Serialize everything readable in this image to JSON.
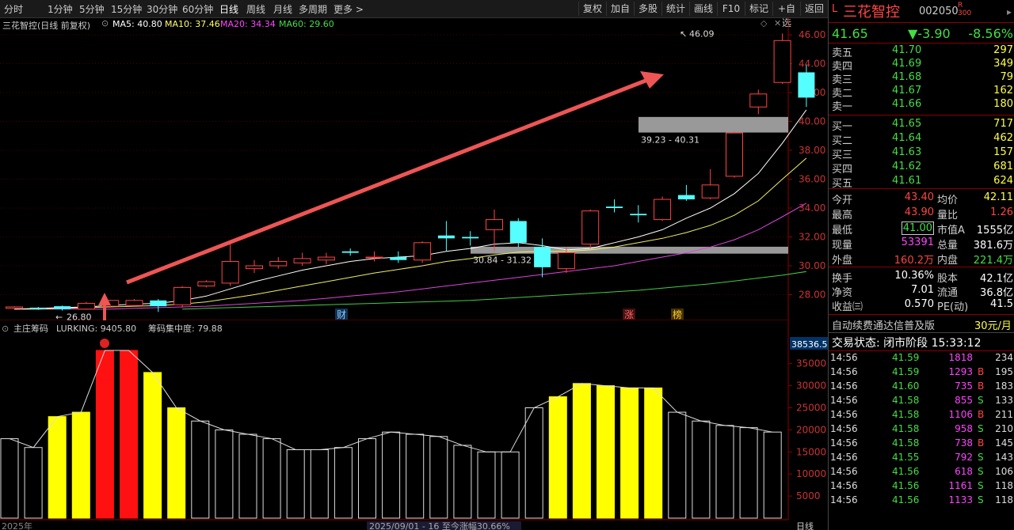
{
  "toolbar": {
    "periods": [
      "分时",
      "1分钟",
      "5分钟",
      "15分钟",
      "30分钟",
      "60分钟",
      "日线",
      "周线",
      "月线",
      "多周期",
      "更多 >"
    ],
    "active_period": "日线",
    "right_buttons": [
      "复权",
      "加自",
      "多股",
      "统计",
      "画线",
      "F10",
      "标记",
      "+自选",
      "返回"
    ]
  },
  "chart": {
    "stock_name": "三花智控(日线 前复权)",
    "ma_labels": [
      {
        "text": "MA5: 40.80",
        "color": "#ffffff"
      },
      {
        "text": "MA10: 37.46",
        "color": "#ffff66"
      },
      {
        "text": "MA20: 34.34",
        "color": "#ff44ff"
      },
      {
        "text": "MA60: 29.60",
        "color": "#44dd44"
      }
    ],
    "price_axis": [
      "46.00",
      "44.00",
      "42.00",
      "40.00",
      "38.00",
      "36.00",
      "34.00",
      "32.00",
      "30.00",
      "28.00"
    ],
    "annotations": {
      "high_label": "46.09",
      "low_label": "26.80",
      "zone_upper": "39.23 - 40.31",
      "zone_lower": "30.84 - 31.32",
      "marker_cai": "财",
      "marker_zhang": "涨",
      "marker_bang": "榜"
    },
    "candles": [
      {
        "o": 27.05,
        "c": 27.15,
        "h": 27.2,
        "l": 27.0
      },
      {
        "o": 27.1,
        "c": 27.0,
        "h": 27.15,
        "l": 26.95
      },
      {
        "o": 27.2,
        "c": 27.0,
        "h": 27.25,
        "l": 26.9
      },
      {
        "o": 27.0,
        "c": 27.4,
        "h": 27.5,
        "l": 26.95
      },
      {
        "o": 27.2,
        "c": 27.6,
        "h": 27.65,
        "l": 27.1
      },
      {
        "o": 27.25,
        "c": 27.6,
        "h": 27.7,
        "l": 27.2
      },
      {
        "o": 27.6,
        "c": 27.2,
        "h": 27.7,
        "l": 26.8
      },
      {
        "o": 27.3,
        "c": 28.5,
        "h": 28.6,
        "l": 27.1
      },
      {
        "o": 28.6,
        "c": 28.9,
        "h": 29.0,
        "l": 28.5
      },
      {
        "o": 28.8,
        "c": 30.3,
        "h": 31.5,
        "l": 28.6
      },
      {
        "o": 29.8,
        "c": 30.0,
        "h": 30.4,
        "l": 29.5
      },
      {
        "o": 30.0,
        "c": 30.3,
        "h": 30.6,
        "l": 29.8
      },
      {
        "o": 30.2,
        "c": 30.5,
        "h": 30.9,
        "l": 30.0
      },
      {
        "o": 30.4,
        "c": 30.6,
        "h": 30.9,
        "l": 30.1
      },
      {
        "o": 31.0,
        "c": 30.9,
        "h": 31.2,
        "l": 30.7
      },
      {
        "o": 30.6,
        "c": 30.6,
        "h": 31.0,
        "l": 30.3
      },
      {
        "o": 30.6,
        "c": 30.4,
        "h": 31.0,
        "l": 30.2
      },
      {
        "o": 30.4,
        "c": 31.6,
        "h": 31.7,
        "l": 30.2
      },
      {
        "o": 32.1,
        "c": 31.9,
        "h": 33.1,
        "l": 31.0
      },
      {
        "o": 32.0,
        "c": 31.9,
        "h": 32.4,
        "l": 31.4
      },
      {
        "o": 32.5,
        "c": 33.2,
        "h": 33.9,
        "l": 31.0
      },
      {
        "o": 33.1,
        "c": 31.6,
        "h": 33.3,
        "l": 31.3
      },
      {
        "o": 31.3,
        "c": 29.9,
        "h": 31.9,
        "l": 29.2
      },
      {
        "o": 29.8,
        "c": 30.9,
        "h": 31.3,
        "l": 29.5
      },
      {
        "o": 31.5,
        "c": 33.8,
        "h": 33.9,
        "l": 31.2
      },
      {
        "o": 34.1,
        "c": 34.0,
        "h": 34.6,
        "l": 33.7
      },
      {
        "o": 33.6,
        "c": 33.5,
        "h": 34.2,
        "l": 33.0
      },
      {
        "o": 33.2,
        "c": 34.6,
        "h": 34.8,
        "l": 33.1
      },
      {
        "o": 34.9,
        "c": 34.6,
        "h": 35.6,
        "l": 34.5
      },
      {
        "o": 34.7,
        "c": 35.6,
        "h": 36.7,
        "l": 34.6
      },
      {
        "o": 36.2,
        "c": 39.2,
        "h": 39.3,
        "l": 36.1
      },
      {
        "o": 41.0,
        "c": 41.9,
        "h": 42.2,
        "l": 40.5
      },
      {
        "o": 42.7,
        "c": 45.6,
        "h": 46.09,
        "l": 42.6
      },
      {
        "o": 43.4,
        "c": 41.65,
        "h": 43.9,
        "l": 41.0
      }
    ],
    "ma5": [
      27.0,
      27.05,
      27.1,
      27.15,
      27.25,
      27.35,
      27.4,
      27.6,
      27.9,
      28.4,
      28.9,
      29.3,
      29.7,
      30.0,
      30.3,
      30.5,
      30.6,
      30.7,
      31.0,
      31.2,
      31.5,
      31.6,
      31.4,
      31.1,
      31.2,
      31.6,
      32.0,
      32.5,
      33.3,
      34.0,
      35.0,
      36.4,
      38.5,
      40.8
    ],
    "ma10": [
      27.0,
      27.0,
      27.05,
      27.1,
      27.15,
      27.2,
      27.25,
      27.35,
      27.5,
      27.75,
      28.0,
      28.3,
      28.6,
      28.9,
      29.2,
      29.5,
      29.75,
      30.0,
      30.3,
      30.5,
      30.75,
      30.95,
      31.0,
      31.0,
      31.1,
      31.3,
      31.6,
      31.9,
      32.3,
      32.8,
      33.5,
      34.5,
      36.0,
      37.46
    ],
    "ma20": [
      27.0,
      27.0,
      27.0,
      27.0,
      27.0,
      27.05,
      27.1,
      27.15,
      27.2,
      27.3,
      27.4,
      27.5,
      27.6,
      27.75,
      27.9,
      28.05,
      28.2,
      28.4,
      28.6,
      28.8,
      29.0,
      29.2,
      29.4,
      29.6,
      29.8,
      30.0,
      30.3,
      30.6,
      30.9,
      31.3,
      31.8,
      32.5,
      33.4,
      34.34
    ],
    "ma60": [
      null,
      null,
      null,
      null,
      null,
      null,
      null,
      27.0,
      27.05,
      27.1,
      27.15,
      27.2,
      27.25,
      27.3,
      27.35,
      27.4,
      27.45,
      27.5,
      27.55,
      27.6,
      27.7,
      27.8,
      27.9,
      28.0,
      28.1,
      28.2,
      28.3,
      28.45,
      28.6,
      28.75,
      28.95,
      29.15,
      29.35,
      29.6
    ]
  },
  "indicator": {
    "title": "主庄筹码",
    "lurking": "LURKING: 9405.80",
    "concentration": "筹码集中度: 79.88",
    "cursor_value": "38536.54",
    "axis": [
      "35000",
      "30000",
      "25000",
      "20000",
      "15000",
      "10000",
      "5000"
    ],
    "bottom_left": "2025年",
    "bottom_center": "2025/09/01 - 16 至今涨幅30.66%",
    "bottom_right": "日线",
    "bars": [
      {
        "v": 18000,
        "c": "k"
      },
      {
        "v": 16000,
        "c": "k"
      },
      {
        "v": 23000,
        "c": "y"
      },
      {
        "v": 24000,
        "c": "y"
      },
      {
        "v": 38000,
        "c": "r"
      },
      {
        "v": 38000,
        "c": "r"
      },
      {
        "v": 33000,
        "c": "y"
      },
      {
        "v": 25000,
        "c": "y"
      },
      {
        "v": 22000,
        "c": "k"
      },
      {
        "v": 20000,
        "c": "k"
      },
      {
        "v": 19000,
        "c": "k"
      },
      {
        "v": 18000,
        "c": "k"
      },
      {
        "v": 15500,
        "c": "k"
      },
      {
        "v": 15500,
        "c": "k"
      },
      {
        "v": 16000,
        "c": "k"
      },
      {
        "v": 18000,
        "c": "k"
      },
      {
        "v": 19500,
        "c": "k"
      },
      {
        "v": 19000,
        "c": "k"
      },
      {
        "v": 18500,
        "c": "k"
      },
      {
        "v": 16500,
        "c": "k"
      },
      {
        "v": 15000,
        "c": "k"
      },
      {
        "v": 15000,
        "c": "k"
      },
      {
        "v": 25000,
        "c": "k"
      },
      {
        "v": 27500,
        "c": "y"
      },
      {
        "v": 30500,
        "c": "y"
      },
      {
        "v": 30000,
        "c": "y"
      },
      {
        "v": 29500,
        "c": "y"
      },
      {
        "v": 29500,
        "c": "y"
      },
      {
        "v": 24000,
        "c": "k"
      },
      {
        "v": 22000,
        "c": "k"
      },
      {
        "v": 21000,
        "c": "k"
      },
      {
        "v": 20500,
        "c": "k"
      },
      {
        "v": 19500,
        "c": "k"
      }
    ]
  },
  "quote": {
    "prefix": "L",
    "name": "三花智控",
    "code": "002050",
    "badge_top": "R",
    "badge_bottom": "300",
    "price": "41.65",
    "change": "▼-3.90",
    "pct": "-8.56%",
    "asks": [
      {
        "label": "卖五",
        "price": "41.70",
        "vol": "297"
      },
      {
        "label": "卖四",
        "price": "41.69",
        "vol": "349"
      },
      {
        "label": "卖三",
        "price": "41.68",
        "vol": "79"
      },
      {
        "label": "卖二",
        "price": "41.67",
        "vol": "162"
      },
      {
        "label": "卖一",
        "price": "41.66",
        "vol": "180"
      }
    ],
    "bids": [
      {
        "label": "买一",
        "price": "41.65",
        "vol": "717"
      },
      {
        "label": "买二",
        "price": "41.64",
        "vol": "462"
      },
      {
        "label": "买三",
        "price": "41.63",
        "vol": "157"
      },
      {
        "label": "买四",
        "price": "41.62",
        "vol": "681"
      },
      {
        "label": "买五",
        "price": "41.61",
        "vol": "624"
      }
    ],
    "stats1": [
      {
        "l1": "今开",
        "v1": "43.40",
        "c1": "#ff4444",
        "l2": "均价",
        "v2": "42.11",
        "c2": "#ffff44"
      },
      {
        "l1": "最高",
        "v1": "43.90",
        "c1": "#ff4444",
        "l2": "量比",
        "v2": "1.26",
        "c2": "#ff4444"
      },
      {
        "l1": "最低",
        "v1": "41.00",
        "c1": "#44dd44",
        "l2": "市值A",
        "v2": "1555亿",
        "c2": "#ffffff"
      },
      {
        "l1": "现量",
        "v1": "53391",
        "c1": "#ff44ff",
        "l2": "总量",
        "v2": "381.6万",
        "c2": "#ffffff"
      },
      {
        "l1": "外盘",
        "v1": "160.2万",
        "c1": "#ff4444",
        "l2": "内盘",
        "v2": "221.4万",
        "c2": "#44dd44"
      }
    ],
    "stats2": [
      {
        "l1": "换手",
        "v1": "10.36%",
        "l2": "股本",
        "v2": "42.1亿"
      },
      {
        "l1": "净资",
        "v1": "7.01",
        "l2": "流通",
        "v2": "36.8亿"
      },
      {
        "l1": "收益㈢",
        "v1": "0.570",
        "l2": "PE(动)",
        "v2": "41.5"
      }
    ],
    "ad_text": "自动续费通达信普及版",
    "ad_price": "30元/月",
    "status": "交易状态: 闭市阶段 15:33:12",
    "ticks": [
      {
        "t": "14:56",
        "p": "41.59",
        "v": "1818",
        "s": "",
        "n": "234"
      },
      {
        "t": "14:56",
        "p": "41.59",
        "v": "1293",
        "s": "B",
        "n": "195"
      },
      {
        "t": "14:56",
        "p": "41.60",
        "v": "735",
        "s": "B",
        "n": "183"
      },
      {
        "t": "14:56",
        "p": "41.58",
        "v": "855",
        "s": "S",
        "n": "133"
      },
      {
        "t": "14:56",
        "p": "41.58",
        "v": "1106",
        "s": "B",
        "n": "211"
      },
      {
        "t": "14:56",
        "p": "41.58",
        "v": "958",
        "s": "S",
        "n": "210"
      },
      {
        "t": "14:56",
        "p": "41.58",
        "v": "738",
        "s": "B",
        "n": "145"
      },
      {
        "t": "14:56",
        "p": "41.55",
        "v": "792",
        "s": "S",
        "n": "143"
      },
      {
        "t": "14:56",
        "p": "41.56",
        "v": "618",
        "s": "S",
        "n": "106"
      },
      {
        "t": "14:56",
        "p": "41.56",
        "v": "1161",
        "s": "S",
        "n": "118"
      },
      {
        "t": "14:56",
        "p": "41.56",
        "v": "1133",
        "s": "S",
        "n": "118"
      }
    ]
  }
}
